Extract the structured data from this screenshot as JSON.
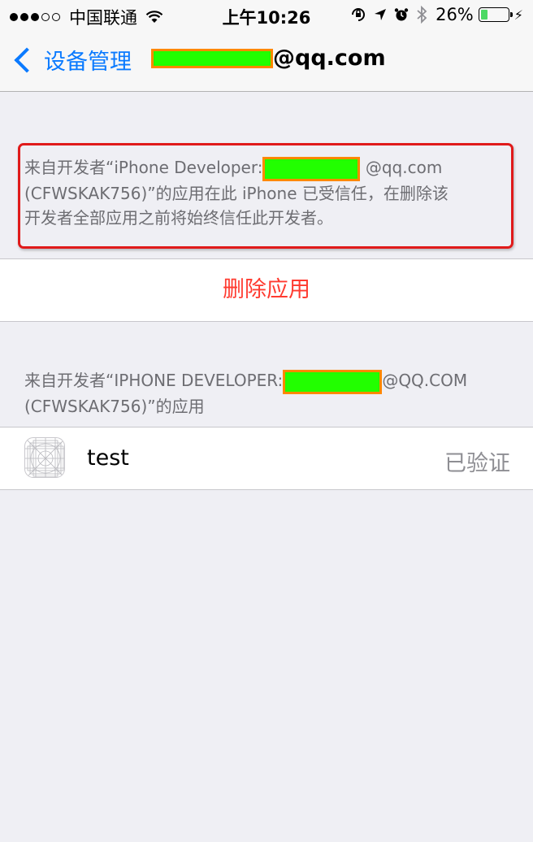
{
  "status_bar": {
    "carrier": "中国联通",
    "time": "上午10:26",
    "battery_percent": "26%",
    "battery_level": 0.26,
    "icons": [
      "signal-dots-icon",
      "wifi-icon",
      "orientation-lock-icon",
      "location-icon",
      "alarm-icon",
      "bluetooth-icon",
      "battery-icon",
      "charging-icon"
    ]
  },
  "nav": {
    "back_label": "设备管理",
    "title_suffix": "@qq.com"
  },
  "notice": {
    "line1_prefix": "来自开发者“iPhone Developer:",
    "line1_suffix": "@qq.com",
    "line2": "(CFWSKAK756)”的应用在此 iPhone 已受信任，在删除该",
    "line3": "开发者全部应用之前将始终信任此开发者。"
  },
  "delete_button": {
    "label": "删除应用"
  },
  "apps_section": {
    "header_prefix": "来自开发者“IPHONE DEVELOPER:",
    "header_suffix": "@QQ.COM",
    "header_line2": "(CFWSKAK756)”的应用"
  },
  "apps": [
    {
      "name": "test",
      "status": "已验证"
    }
  ],
  "colors": {
    "accent": "#0a7aff",
    "destructive": "#ff3b30",
    "redaction_fill": "#22ff00",
    "redaction_border": "#ff8800",
    "annotation_border": "#e01a1a",
    "background": "#efeff4"
  }
}
